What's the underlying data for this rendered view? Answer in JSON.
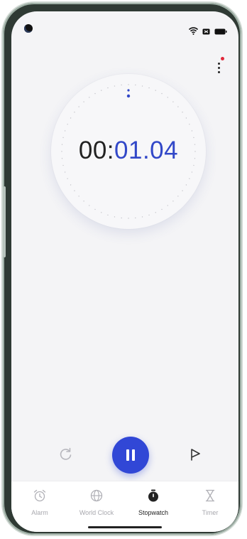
{
  "app": {
    "stopwatch_time": {
      "minutes": "00:",
      "seconds": "01.04"
    },
    "accent_color": "#3248c8",
    "menu_icon": "more-vertical-icon"
  },
  "status_bar": {
    "icons": [
      "wifi-icon",
      "sim-icon",
      "battery-icon"
    ]
  },
  "controls": {
    "left": "reset-icon",
    "center": "pause-icon",
    "right": "lap-flag-icon"
  },
  "tabs": [
    {
      "label": "Alarm",
      "icon": "alarm-clock-icon",
      "active": false
    },
    {
      "label": "World Clock",
      "icon": "globe-icon",
      "active": false
    },
    {
      "label": "Stopwatch",
      "icon": "stopwatch-icon",
      "active": true
    },
    {
      "label": "Timer",
      "icon": "hourglass-icon",
      "active": false
    }
  ]
}
